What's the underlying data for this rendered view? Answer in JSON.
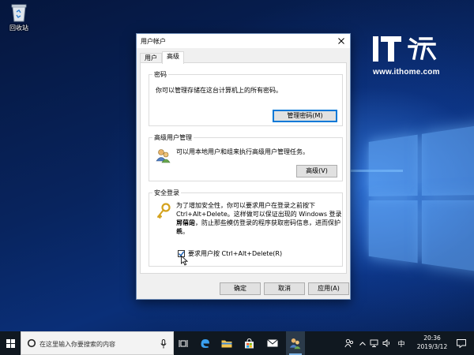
{
  "desktop": {
    "recycle_bin_label": "回收站",
    "watermark": {
      "logo_text": "IT之家",
      "url": "www.ithome.com"
    }
  },
  "dialog": {
    "title": "用户帐户",
    "tabs": [
      {
        "label": "用户",
        "active": false
      },
      {
        "label": "高级",
        "active": true
      }
    ],
    "groups": {
      "password": {
        "title": "密码",
        "description": "你可以管理存储在这台计算机上的所有密码。",
        "button_label": "管理密码(M)"
      },
      "advanced_user_management": {
        "title": "高级用户管理",
        "description": "可以用本地用户和组来执行高级用户管理任务。",
        "button_label": "高级(V)"
      },
      "secure_logon": {
        "title": "安全登录",
        "description_lines": [
          "为了增加安全性，你可以要求用户在登录之前按下",
          "Ctrl+Alt+Delete。这样做可以保证出现的 Windows 登录屏幕是",
          "可信的，防止那些模仿登录的程序获取密码信息，进而保护系",
          "统。"
        ],
        "checkbox_label": "要求用户按 Ctrl+Alt+Delete(R)",
        "checkbox_checked": true
      }
    },
    "footer": {
      "ok_label": "确定",
      "cancel_label": "取消",
      "apply_label": "应用(A)"
    }
  },
  "taskbar": {
    "search_placeholder": "在这里输入你要搜索的内容",
    "clock_time": "20:36",
    "clock_date": "2019/3/12",
    "ime_label": "中",
    "colors": {
      "taskbar_bg": "#101820",
      "accent": "#0078d7"
    }
  }
}
